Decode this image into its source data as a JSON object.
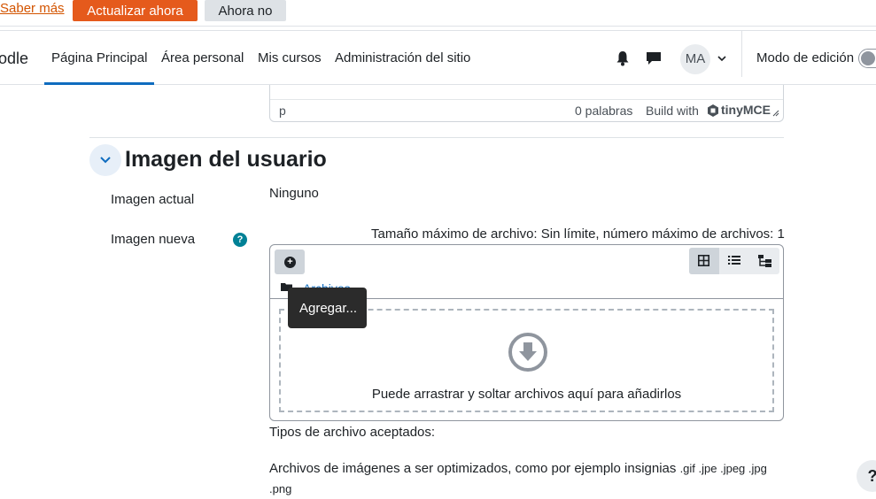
{
  "notice": {
    "learn_more": "Saber más",
    "update_now": "Actualizar ahora",
    "not_now": "Ahora no"
  },
  "navbar": {
    "brand": "odle",
    "links": [
      "Página Principal",
      "Área personal",
      "Mis cursos",
      "Administración del sitio"
    ],
    "avatar_initials": "MA",
    "edit_mode_label": "Modo de edición"
  },
  "editor_status": {
    "path": "p",
    "word_count": "0 palabras",
    "build_with": "Build with",
    "brand": "tinyMCE"
  },
  "section": {
    "title": "Imagen del usuario",
    "current_label": "Imagen actual",
    "current_value": "Ninguno",
    "new_label": "Imagen nueva",
    "help_glyph": "?",
    "max_size_text": "Tamaño máximo de archivo: Sin límite, número máximo de archivos: 1"
  },
  "filepicker": {
    "add_glyph": "+",
    "folder_label": "Archivos",
    "tooltip": "Agregar...",
    "drop_text": "Puede arrastrar y soltar archivos aquí para añadirlos",
    "views": [
      "grid-view-icon",
      "list-view-icon",
      "tree-view-icon"
    ]
  },
  "accepted": {
    "heading": "Tipos de archivo aceptados:",
    "description": "Archivos de imágenes a ser optimizados, como por ejemplo insignias",
    "extensions": ".gif .jpe .jpeg .jpg",
    "extensions_wrap": ".png"
  },
  "help_button": "?",
  "colors": {
    "accent": "#0f6cbf",
    "update_button": "#e55a1c",
    "help_icon": "#008196"
  }
}
